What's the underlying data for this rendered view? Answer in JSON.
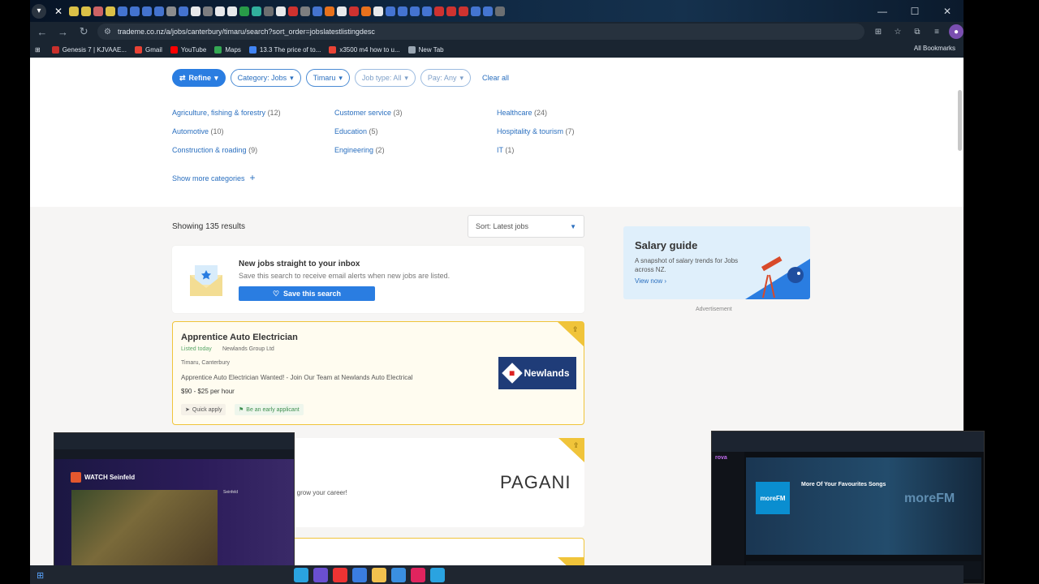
{
  "browser": {
    "url": "trademe.co.nz/a/jobs/canterbury/timaru/search?sort_order=jobslatestlistingdesc",
    "tab_icon_colors": [
      "#f2d34a",
      "#f2d34a",
      "#e26a6a",
      "#f2d34a",
      "#4a7de1",
      "#4a7de1",
      "#4a7de1",
      "#4a7de1",
      "#999",
      "#4a7de1",
      "#fff",
      "#888",
      "#fff",
      "#fff",
      "#2ba84a",
      "#35c0a8",
      "#777",
      "#fff",
      "#e3342f",
      "#888",
      "#4a7de1",
      "#ff7a1a",
      "#fff",
      "#e3342f",
      "#ff7a1a",
      "#fff",
      "#4a7de1",
      "#4a7de1",
      "#4a7de1",
      "#4a7de1",
      "#e3342f",
      "#e3342f",
      "#e3342f",
      "#4a7de1",
      "#4a7de1",
      "#777"
    ],
    "bookmarks": [
      {
        "label": "Genesis 7 | KJVAAE...",
        "color": "#c9302c"
      },
      {
        "label": "Gmail",
        "color": "#e94235"
      },
      {
        "label": "YouTube",
        "color": "#ff0000"
      },
      {
        "label": "Maps",
        "color": "#34a853"
      },
      {
        "label": "13.3 The price of to...",
        "color": "#4285f4"
      },
      {
        "label": "x3500 m4 how to u...",
        "color": "#ea4335"
      },
      {
        "label": "New Tab",
        "color": "#9aa6b2"
      }
    ],
    "all_bookmarks": "All Bookmarks"
  },
  "filters": {
    "refine": "Refine",
    "category": "Category: Jobs",
    "location": "Timaru",
    "job_type": "Job type: All",
    "pay": "Pay: Any",
    "clear_all": "Clear all"
  },
  "categories": [
    {
      "name": "Agriculture, fishing & forestry",
      "count": "(12)"
    },
    {
      "name": "Customer service",
      "count": "(3)"
    },
    {
      "name": "Healthcare",
      "count": "(24)"
    },
    {
      "name": "Automotive",
      "count": "(10)"
    },
    {
      "name": "Education",
      "count": "(5)"
    },
    {
      "name": "Hospitality & tourism",
      "count": "(7)"
    },
    {
      "name": "Construction & roading",
      "count": "(9)"
    },
    {
      "name": "Engineering",
      "count": "(2)"
    },
    {
      "name": "IT",
      "count": "(1)"
    }
  ],
  "show_more": "Show more categories",
  "results": {
    "showing": "Showing 135 results",
    "sort": "Sort: Latest jobs"
  },
  "alert": {
    "title": "New jobs straight to your inbox",
    "subtitle": "Save this search to receive email alerts when new jobs are listed.",
    "button": "Save this search"
  },
  "job1": {
    "title": "Apprentice Auto Electrician",
    "listed": "Listed today",
    "company": "Newlands Group Ltd",
    "location": "Timaru, Canterbury",
    "description": "Apprentice Auto Electrician Wanted! - Join Our Team at Newlands Auto Electrical",
    "pay": "$90 - $25 per hour",
    "quick_apply": "Quick apply",
    "early": "Be an early applicant",
    "logo_text": "Newlands"
  },
  "job2": {
    "description_fragment": "rt of a leading top fashion brand that will grow your career!",
    "logo_text": "PAGANI"
  },
  "salary": {
    "title": "Salary guide",
    "subtitle": "A snapshot of salary trends for Jobs across NZ.",
    "link": "View now"
  },
  "advertisement": "Advertisement",
  "overlay_left": {
    "title": "WATCH Seinfeld",
    "details": "Seinfeld"
  },
  "overlay_right": {
    "brand": "rova",
    "title": "More Of Your Favourites Songs",
    "logo": "moreFM",
    "watermark": "moreFM"
  },
  "taskbar_icon_colors": [
    "#2aa3e0",
    "#6a4fd1",
    "#e33",
    "#3a7de0",
    "#f2c14e",
    "#3a8fe0",
    "#e0245e",
    "#2aa3e0"
  ]
}
